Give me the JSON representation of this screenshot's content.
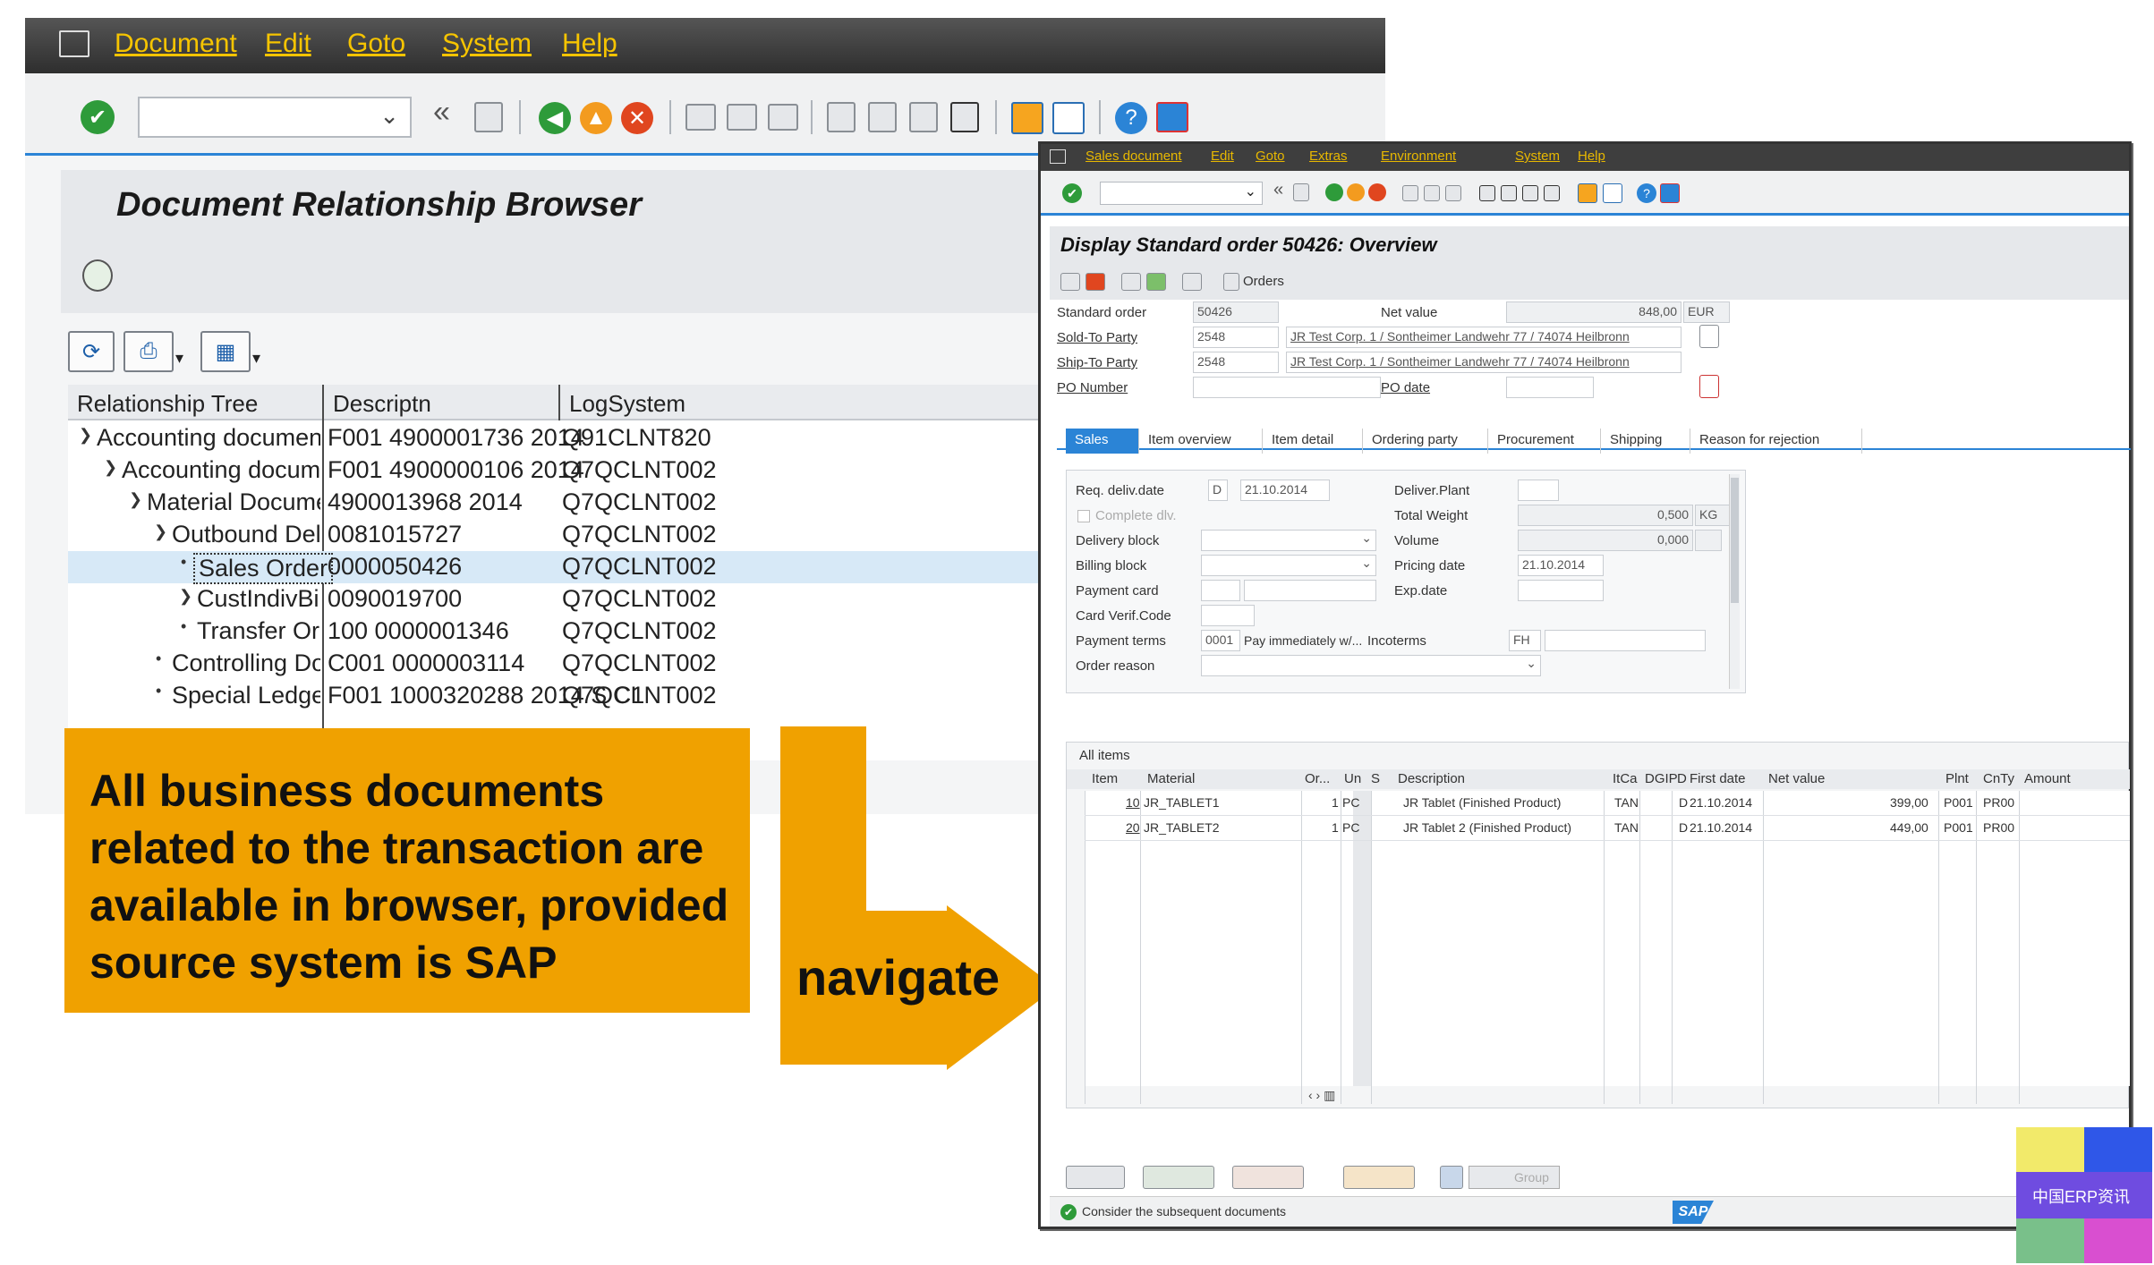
{
  "left_window": {
    "menu": [
      "Document",
      "Edit",
      "Goto",
      "System",
      "Help"
    ],
    "title": "Document Relationship Browser",
    "grid_headers": [
      "Relationship Tree",
      "Descriptn",
      "LogSystem"
    ],
    "rows": [
      {
        "name": "Accounting document",
        "desc": "F001 4900001736 2014",
        "log": "Q91CLNT820"
      },
      {
        "name": "Accounting document",
        "desc": "F001 4900000106 2014",
        "log": "Q7QCLNT002"
      },
      {
        "name": "Material Document",
        "desc": "4900013968 2014",
        "log": "Q7QCLNT002"
      },
      {
        "name": "Outbound Delivery",
        "desc": "0081015727",
        "log": "Q7QCLNT002"
      },
      {
        "name": "Sales Order",
        "desc": "0000050426",
        "log": "Q7QCLNT002"
      },
      {
        "name": "CustIndivBillingDoc",
        "desc": "0090019700",
        "log": "Q7QCLNT002"
      },
      {
        "name": "Transfer Order",
        "desc": "100 0000001346",
        "log": "Q7QCLNT002"
      },
      {
        "name": "Controlling Document",
        "desc": "C001 0000003114",
        "log": "Q7QCLNT002"
      },
      {
        "name": "Special Ledger Document",
        "desc": "F001 1000320288 2014 S C1",
        "log": "Q7QCLNT002"
      }
    ]
  },
  "callout": {
    "text": "All business documents related to the transaction are available in browser, provided source system is SAP",
    "navigate": "navigate"
  },
  "right_window": {
    "menu": [
      "Sales document",
      "Edit",
      "Goto",
      "Extras",
      "Environment",
      "System",
      "Help"
    ],
    "title": "Display Standard order 50426: Overview",
    "orders_btn": "Orders",
    "header": {
      "standard_order_label": "Standard order",
      "standard_order": "50426",
      "net_value_label": "Net value",
      "net_value": "848,00",
      "currency": "EUR",
      "sold_to_label": "Sold-To Party",
      "sold_to": "2548",
      "sold_to_desc": "JR Test Corp. 1 / Sontheimer Landwehr 77 / 74074 Heilbronn",
      "ship_to_label": "Ship-To Party",
      "ship_to": "2548",
      "ship_to_desc": "JR Test Corp. 1 / Sontheimer Landwehr 77 / 74074 Heilbronn",
      "po_number_label": "PO Number",
      "po_date_label": "PO date"
    },
    "tabs": [
      "Sales",
      "Item overview",
      "Item detail",
      "Ordering party",
      "Procurement",
      "Shipping",
      "Reason for rejection"
    ],
    "sales": {
      "req_deliv_label": "Req. deliv.date",
      "req_deliv_type": "D",
      "req_deliv": "21.10.2014",
      "complete_dlv_label": "Complete dlv.",
      "delivery_block_label": "Delivery block",
      "billing_block_label": "Billing block",
      "payment_card_label": "Payment card",
      "card_verif_label": "Card Verif.Code",
      "payment_terms_label": "Payment terms",
      "payment_terms": "0001",
      "payment_terms_desc": "Pay immediately w/...",
      "order_reason_label": "Order reason",
      "deliver_plant_label": "Deliver.Plant",
      "total_weight_label": "Total Weight",
      "total_weight": "0,500",
      "weight_unit": "KG",
      "volume_label": "Volume",
      "volume": "0,000",
      "pricing_date_label": "Pricing date",
      "pricing_date": "21.10.2014",
      "exp_date_label": "Exp.date",
      "incoterms_label": "Incoterms",
      "incoterms": "FH"
    },
    "items": {
      "section_label": "All items",
      "headers": [
        "Item",
        "Material",
        "Or...",
        "Un",
        "S",
        "Description",
        "ItCa",
        "DGIP",
        "D",
        "First date",
        "Net value",
        "Plnt",
        "CnTy",
        "Amount"
      ],
      "rows": [
        {
          "item": "10",
          "material": "JR_TABLET1",
          "qty": "1",
          "unit": "PC",
          "desc": "JR Tablet (Finished Product)",
          "itca": "TAN",
          "d": "D",
          "date": "21.10.2014",
          "net": "399,00",
          "plnt": "P001",
          "cnty": "PR00"
        },
        {
          "item": "20",
          "material": "JR_TABLET2",
          "qty": "1",
          "unit": "PC",
          "desc": "JR Tablet 2 (Finished Product)",
          "itca": "TAN",
          "d": "D",
          "date": "21.10.2014",
          "net": "449,00",
          "plnt": "P001",
          "cnty": "PR00"
        }
      ]
    },
    "group_btn": "Group",
    "status": "Consider the subsequent documents",
    "sap_logo": "SAP"
  },
  "watermark": "中国ERP资讯",
  "colors": {
    "accent": "#f0a100",
    "sap_blue": "#2b84d6",
    "menu_gold": "#f6c400"
  }
}
